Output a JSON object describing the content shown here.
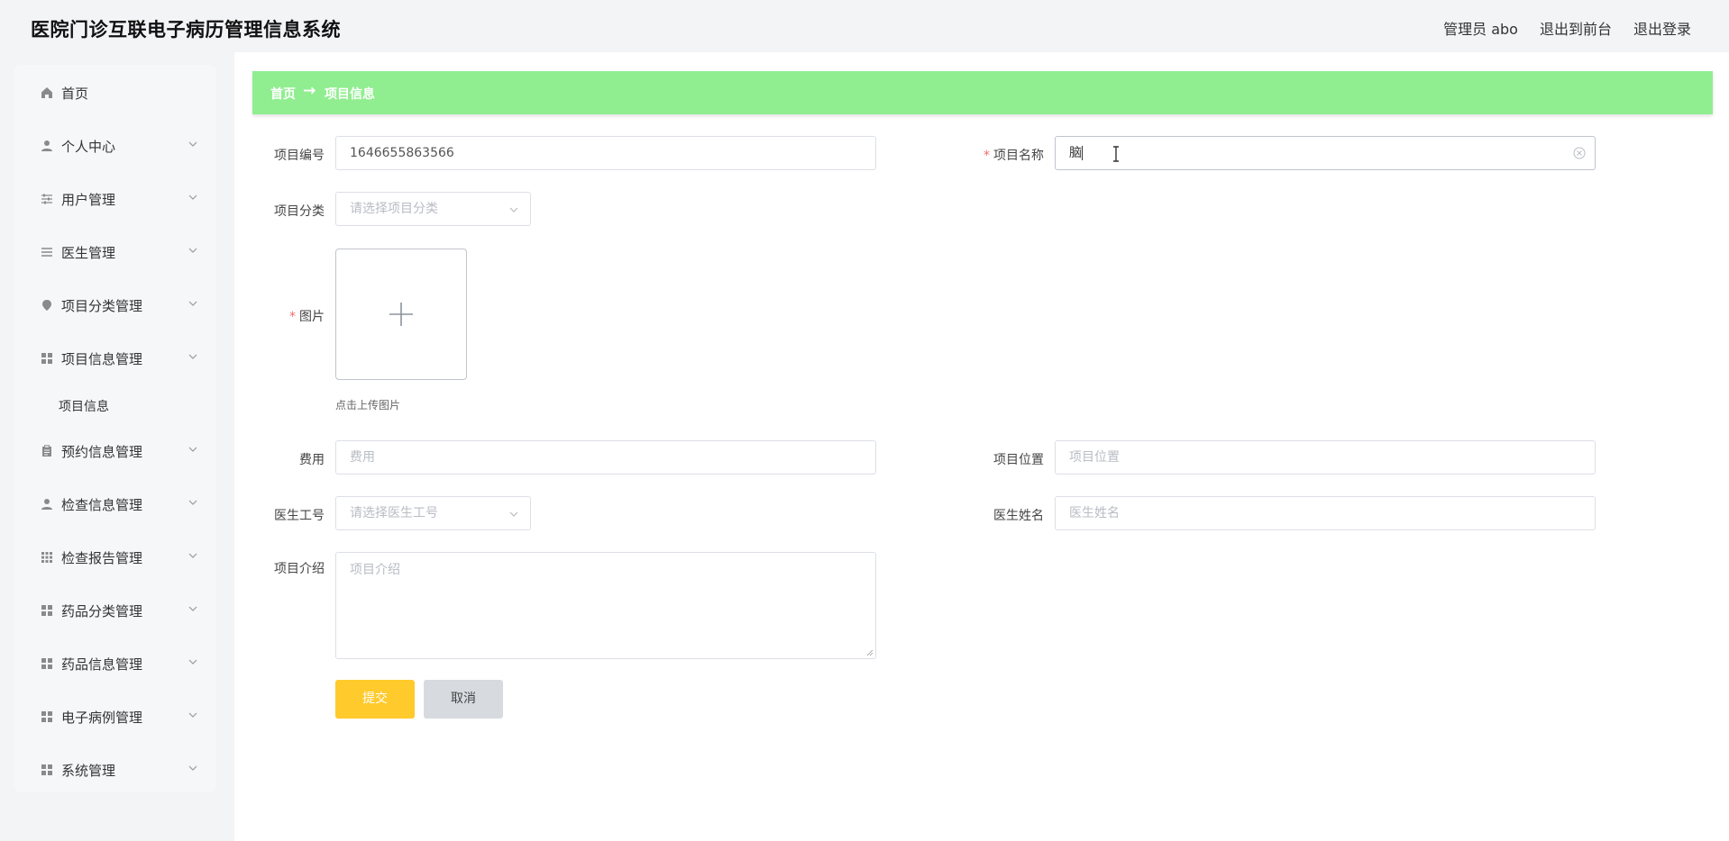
{
  "app": {
    "title": "医院门诊互联电子病历管理信息系统"
  },
  "header": {
    "user": "管理员 abo",
    "front_link": "退出到前台",
    "logout": "退出登录"
  },
  "sidebar": {
    "items": [
      {
        "label": "首页",
        "icon": "home-icon",
        "has_children": false
      },
      {
        "label": "个人中心",
        "icon": "user-icon",
        "has_children": true
      },
      {
        "label": "用户管理",
        "icon": "sliders-icon",
        "has_children": true
      },
      {
        "label": "医生管理",
        "icon": "list-icon",
        "has_children": true
      },
      {
        "label": "项目分类管理",
        "icon": "location-icon",
        "has_children": true
      },
      {
        "label": "项目信息管理",
        "icon": "grid-icon",
        "has_children": true,
        "expanded": true
      },
      {
        "label": "预约信息管理",
        "icon": "clipboard-icon",
        "has_children": true
      },
      {
        "label": "检查信息管理",
        "icon": "user-icon",
        "has_children": true
      },
      {
        "label": "检查报告管理",
        "icon": "apps-icon",
        "has_children": true
      },
      {
        "label": "药品分类管理",
        "icon": "grid-icon",
        "has_children": true
      },
      {
        "label": "药品信息管理",
        "icon": "grid-icon",
        "has_children": true
      },
      {
        "label": "电子病例管理",
        "icon": "grid-icon",
        "has_children": true
      },
      {
        "label": "系统管理",
        "icon": "grid-icon",
        "has_children": true
      }
    ],
    "sub_item": "项目信息"
  },
  "breadcrumb": {
    "home": "首页",
    "arrow": "→",
    "current": "项目信息"
  },
  "form": {
    "code_label": "项目编号",
    "code_value": "1646655863566",
    "name_label": "项目名称",
    "name_value": "脑",
    "category_label": "项目分类",
    "category_placeholder": "请选择项目分类",
    "image_label": "图片",
    "upload_hint": "点击上传图片",
    "fee_label": "费用",
    "fee_placeholder": "费用",
    "location_label": "项目位置",
    "location_placeholder": "项目位置",
    "doctor_id_label": "医生工号",
    "doctor_id_placeholder": "请选择医生工号",
    "doctor_name_label": "医生姓名",
    "doctor_name_placeholder": "医生姓名",
    "intro_label": "项目介绍",
    "intro_placeholder": "项目介绍",
    "submit": "提交",
    "cancel": "取消"
  },
  "colors": {
    "breadcrumb_bg": "#90ee90",
    "submit_bg": "#ffca2c",
    "cancel_bg": "#d7dbe0",
    "required": "#f56c6c"
  }
}
